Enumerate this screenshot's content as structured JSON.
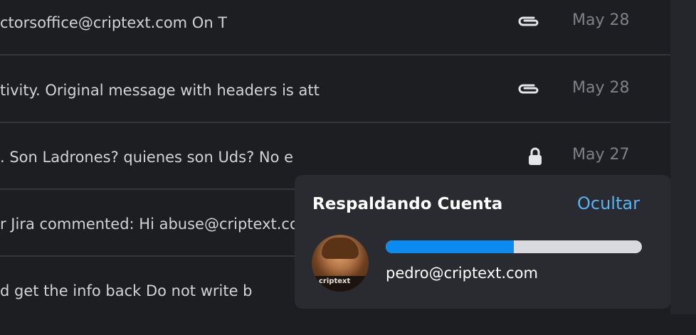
{
  "email_list": {
    "rows": [
      {
        "preview": "ctorsoffice@criptext.com On T",
        "icon": "paperclip-icon",
        "date": "May 28"
      },
      {
        "preview": "tivity. Original message with headers is att",
        "icon": "paperclip-icon",
        "date": "May 28"
      },
      {
        "preview": ". Son Ladrones? quienes son Uds? No e",
        "icon": "lock-icon",
        "date": "May 27"
      },
      {
        "preview": "r Jira commented: Hi abuse@criptext.co",
        "icon": "",
        "date": ""
      },
      {
        "preview": "d get the info back Do not write b",
        "icon": "",
        "date": ""
      }
    ]
  },
  "backup_toast": {
    "title": "Respaldando Cuenta",
    "hide_label": "Ocultar",
    "email": "pedro@criptext.com",
    "progress": 0.5,
    "avatar_brand_text": "criptext"
  },
  "colors": {
    "accent": "#54b4f5",
    "progress_fill": "#0b8af0",
    "progress_track": "#d8dadf",
    "background": "#1d1e22"
  }
}
